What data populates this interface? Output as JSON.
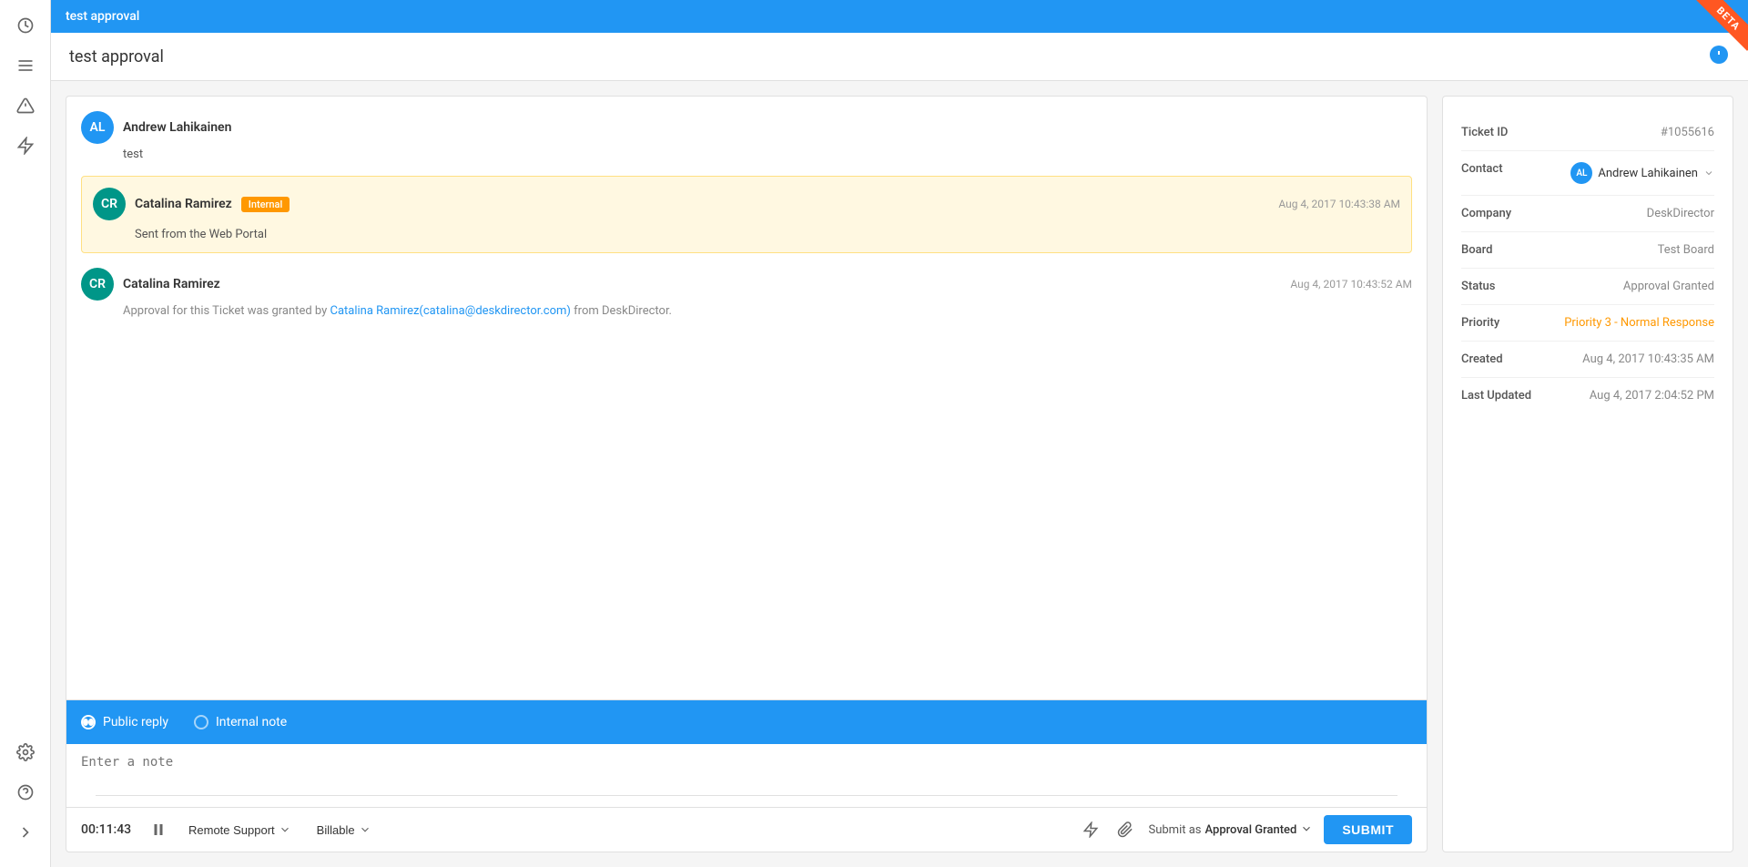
{
  "app": {
    "tab_title": "test approval",
    "page_title": "test approval",
    "beta_label": "BETA"
  },
  "sidebar": {
    "icons": [
      {
        "name": "clock-icon",
        "glyph": "🕐"
      },
      {
        "name": "list-icon",
        "glyph": "☰"
      },
      {
        "name": "alert-icon",
        "glyph": "🔔"
      },
      {
        "name": "bolt-icon",
        "glyph": "⚡"
      },
      {
        "name": "settings-icon",
        "glyph": "⚙"
      },
      {
        "name": "help-icon",
        "glyph": "?"
      },
      {
        "name": "expand-icon",
        "glyph": ">"
      }
    ]
  },
  "ticket": {
    "first_message": {
      "author": "Andrew Lahikainen",
      "avatar_initials": "AL",
      "text": "test"
    },
    "internal_message": {
      "author": "Catalina Ramirez",
      "avatar_initials": "CR",
      "badge": "Internal",
      "time": "Aug 4, 2017 10:43:38 AM",
      "text": "Sent from the Web Portal"
    },
    "approval_message": {
      "author": "Catalina Ramirez",
      "avatar_initials": "CR",
      "time": "Aug 4, 2017 10:43:52 AM",
      "approval_text": "Approval for this Ticket was granted by Catalina Ramirez(catalina@deskdirector.com) from DeskDirector."
    }
  },
  "reply": {
    "public_reply_label": "Public reply",
    "internal_note_label": "Internal note",
    "note_placeholder": "Enter a note",
    "timer": "00:11:43",
    "type_label": "Remote Support",
    "billing_label": "Billable",
    "submit_as_prefix": "Submit as",
    "submit_as_value": "Approval Granted",
    "submit_button_label": "SUBMIT"
  },
  "details": {
    "ticket_id_label": "Ticket ID",
    "ticket_id_value": "#1055616",
    "contact_label": "Contact",
    "contact_name": "Andrew Lahikainen",
    "contact_initials": "AL",
    "company_label": "Company",
    "company_value": "DeskDirector",
    "board_label": "Board",
    "board_value": "Test Board",
    "status_label": "Status",
    "status_value": "Approval Granted",
    "priority_label": "Priority",
    "priority_value": "Priority 3 - Normal Response",
    "created_label": "Created",
    "created_value": "Aug 4, 2017 10:43:35 AM",
    "last_updated_label": "Last Updated",
    "last_updated_value": "Aug 4, 2017 2:04:52 PM"
  }
}
